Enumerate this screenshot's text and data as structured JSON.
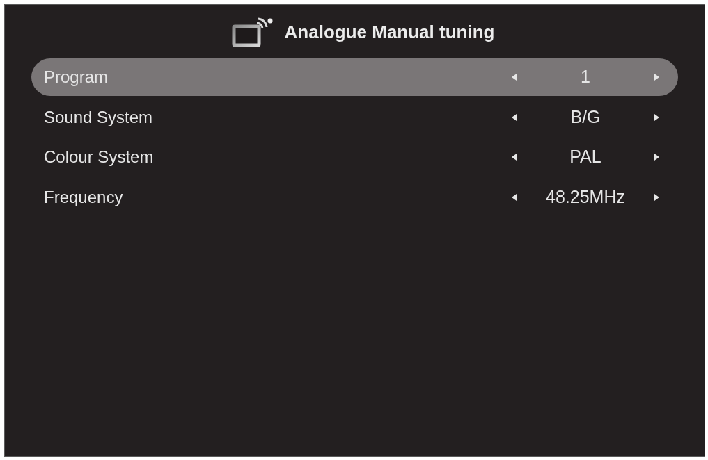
{
  "title": "Analogue Manual tuning",
  "items": [
    {
      "label": "Program",
      "value": "1",
      "selected": true
    },
    {
      "label": "Sound System",
      "value": "B/G",
      "selected": false
    },
    {
      "label": "Colour System",
      "value": "PAL",
      "selected": false
    },
    {
      "label": "Frequency",
      "value": "48.25MHz",
      "selected": false
    }
  ]
}
